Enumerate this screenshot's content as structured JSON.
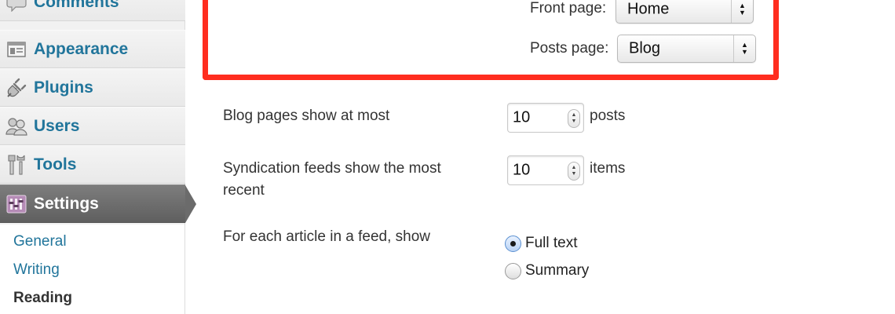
{
  "sidebar": {
    "items": [
      {
        "label": "Comments",
        "icon": "comments-icon"
      },
      {
        "label": "Appearance",
        "icon": "appearance-icon"
      },
      {
        "label": "Plugins",
        "icon": "plugins-icon"
      },
      {
        "label": "Users",
        "icon": "users-icon"
      },
      {
        "label": "Tools",
        "icon": "tools-icon"
      },
      {
        "label": "Settings",
        "icon": "settings-icon",
        "current": true
      }
    ],
    "submenu": [
      {
        "label": "General"
      },
      {
        "label": "Writing"
      },
      {
        "label": "Reading",
        "active": true
      }
    ]
  },
  "front_page": {
    "front_label": "Front page:",
    "front_value": "Home",
    "posts_label": "Posts page:",
    "posts_value": "Blog",
    "highlight_color": "#ff2d1f"
  },
  "settings": {
    "blog_pages_label": "Blog pages show at most",
    "blog_pages_value": "10",
    "blog_pages_unit": "posts",
    "feeds_label_line1": "Syndication feeds show the most",
    "feeds_label_line2": "recent",
    "feeds_value": "10",
    "feeds_unit": "items",
    "article_label": "For each article in a feed, show",
    "option_full": "Full text",
    "option_summary": "Summary",
    "selected_option": "Full text"
  },
  "colors": {
    "link": "#21759b",
    "current_menu_bg": "#6b6b6b"
  }
}
